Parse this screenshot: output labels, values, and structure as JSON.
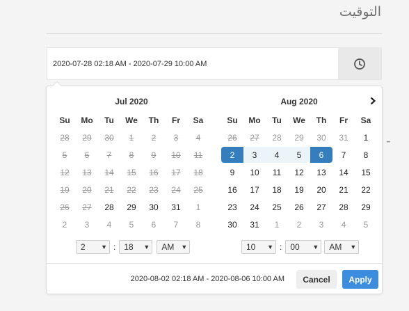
{
  "page": {
    "title": "التوقيت"
  },
  "range_input": {
    "value": "2020-07-28 02:18 AM - 2020-07-29 10:00 AM"
  },
  "icons": {
    "clock": "clock-icon",
    "next": "chevron-right-icon",
    "dropdown": "chevron-down-icon"
  },
  "colors": {
    "selected": "#357ebd",
    "in_range": "#ebf4f8",
    "apply": "#3c8dde"
  },
  "weekdays": [
    "Su",
    "Mo",
    "Tu",
    "We",
    "Th",
    "Fr",
    "Sa"
  ],
  "left_calendar": {
    "month": "Jul 2020",
    "rows": [
      [
        {
          "d": "28",
          "s": "dis"
        },
        {
          "d": "29",
          "s": "dis"
        },
        {
          "d": "30",
          "s": "dis"
        },
        {
          "d": "1",
          "s": "dis"
        },
        {
          "d": "2",
          "s": "dis"
        },
        {
          "d": "3",
          "s": "dis"
        },
        {
          "d": "4",
          "s": "dis"
        }
      ],
      [
        {
          "d": "5",
          "s": "dis"
        },
        {
          "d": "6",
          "s": "dis"
        },
        {
          "d": "7",
          "s": "dis"
        },
        {
          "d": "8",
          "s": "dis"
        },
        {
          "d": "9",
          "s": "dis"
        },
        {
          "d": "10",
          "s": "dis"
        },
        {
          "d": "11",
          "s": "dis"
        }
      ],
      [
        {
          "d": "12",
          "s": "dis"
        },
        {
          "d": "13",
          "s": "dis"
        },
        {
          "d": "14",
          "s": "dis"
        },
        {
          "d": "15",
          "s": "dis"
        },
        {
          "d": "16",
          "s": "dis"
        },
        {
          "d": "17",
          "s": "dis"
        },
        {
          "d": "18",
          "s": "dis"
        }
      ],
      [
        {
          "d": "19",
          "s": "dis"
        },
        {
          "d": "20",
          "s": "dis"
        },
        {
          "d": "21",
          "s": "dis"
        },
        {
          "d": "22",
          "s": "dis"
        },
        {
          "d": "23",
          "s": "dis"
        },
        {
          "d": "24",
          "s": "dis"
        },
        {
          "d": "25",
          "s": "dis"
        }
      ],
      [
        {
          "d": "26",
          "s": "dis"
        },
        {
          "d": "27",
          "s": "dis"
        },
        {
          "d": "28",
          "s": "cur"
        },
        {
          "d": "29",
          "s": "cur"
        },
        {
          "d": "30",
          "s": "cur"
        },
        {
          "d": "31",
          "s": "cur"
        },
        {
          "d": "1",
          "s": "off"
        }
      ],
      [
        {
          "d": "2",
          "s": "off"
        },
        {
          "d": "3",
          "s": "off"
        },
        {
          "d": "4",
          "s": "off"
        },
        {
          "d": "5",
          "s": "off"
        },
        {
          "d": "6",
          "s": "off"
        },
        {
          "d": "7",
          "s": "off"
        },
        {
          "d": "8",
          "s": "off"
        }
      ]
    ],
    "time": {
      "hour": "2",
      "minute": "18",
      "ampm": "AM"
    }
  },
  "right_calendar": {
    "month": "Aug 2020",
    "rows": [
      [
        {
          "d": "26",
          "s": "dis"
        },
        {
          "d": "27",
          "s": "dis"
        },
        {
          "d": "28",
          "s": "off"
        },
        {
          "d": "29",
          "s": "off"
        },
        {
          "d": "30",
          "s": "off"
        },
        {
          "d": "31",
          "s": "off"
        },
        {
          "d": "1",
          "s": "cur"
        }
      ],
      [
        {
          "d": "2",
          "s": "sel-start"
        },
        {
          "d": "3",
          "s": "in-range"
        },
        {
          "d": "4",
          "s": "in-range"
        },
        {
          "d": "5",
          "s": "in-range"
        },
        {
          "d": "6",
          "s": "sel-end"
        },
        {
          "d": "7",
          "s": "cur"
        },
        {
          "d": "8",
          "s": "cur"
        }
      ],
      [
        {
          "d": "9",
          "s": "cur"
        },
        {
          "d": "10",
          "s": "cur"
        },
        {
          "d": "11",
          "s": "cur"
        },
        {
          "d": "12",
          "s": "cur"
        },
        {
          "d": "13",
          "s": "cur"
        },
        {
          "d": "14",
          "s": "cur"
        },
        {
          "d": "15",
          "s": "cur"
        }
      ],
      [
        {
          "d": "16",
          "s": "cur"
        },
        {
          "d": "17",
          "s": "cur"
        },
        {
          "d": "18",
          "s": "cur"
        },
        {
          "d": "19",
          "s": "cur"
        },
        {
          "d": "20",
          "s": "cur"
        },
        {
          "d": "21",
          "s": "cur"
        },
        {
          "d": "22",
          "s": "cur"
        }
      ],
      [
        {
          "d": "23",
          "s": "cur"
        },
        {
          "d": "24",
          "s": "cur"
        },
        {
          "d": "25",
          "s": "cur"
        },
        {
          "d": "26",
          "s": "cur"
        },
        {
          "d": "27",
          "s": "cur"
        },
        {
          "d": "28",
          "s": "cur"
        },
        {
          "d": "29",
          "s": "cur"
        }
      ],
      [
        {
          "d": "30",
          "s": "cur"
        },
        {
          "d": "31",
          "s": "cur"
        },
        {
          "d": "1",
          "s": "off"
        },
        {
          "d": "2",
          "s": "off"
        },
        {
          "d": "3",
          "s": "off"
        },
        {
          "d": "4",
          "s": "off"
        },
        {
          "d": "5",
          "s": "off"
        }
      ]
    ],
    "time": {
      "hour": "10",
      "minute": "00",
      "ampm": "AM"
    }
  },
  "footer": {
    "range_text": "2020-08-02 02:18 AM - 2020-08-06 10:00 AM",
    "cancel_label": "Cancel",
    "apply_label": "Apply"
  }
}
